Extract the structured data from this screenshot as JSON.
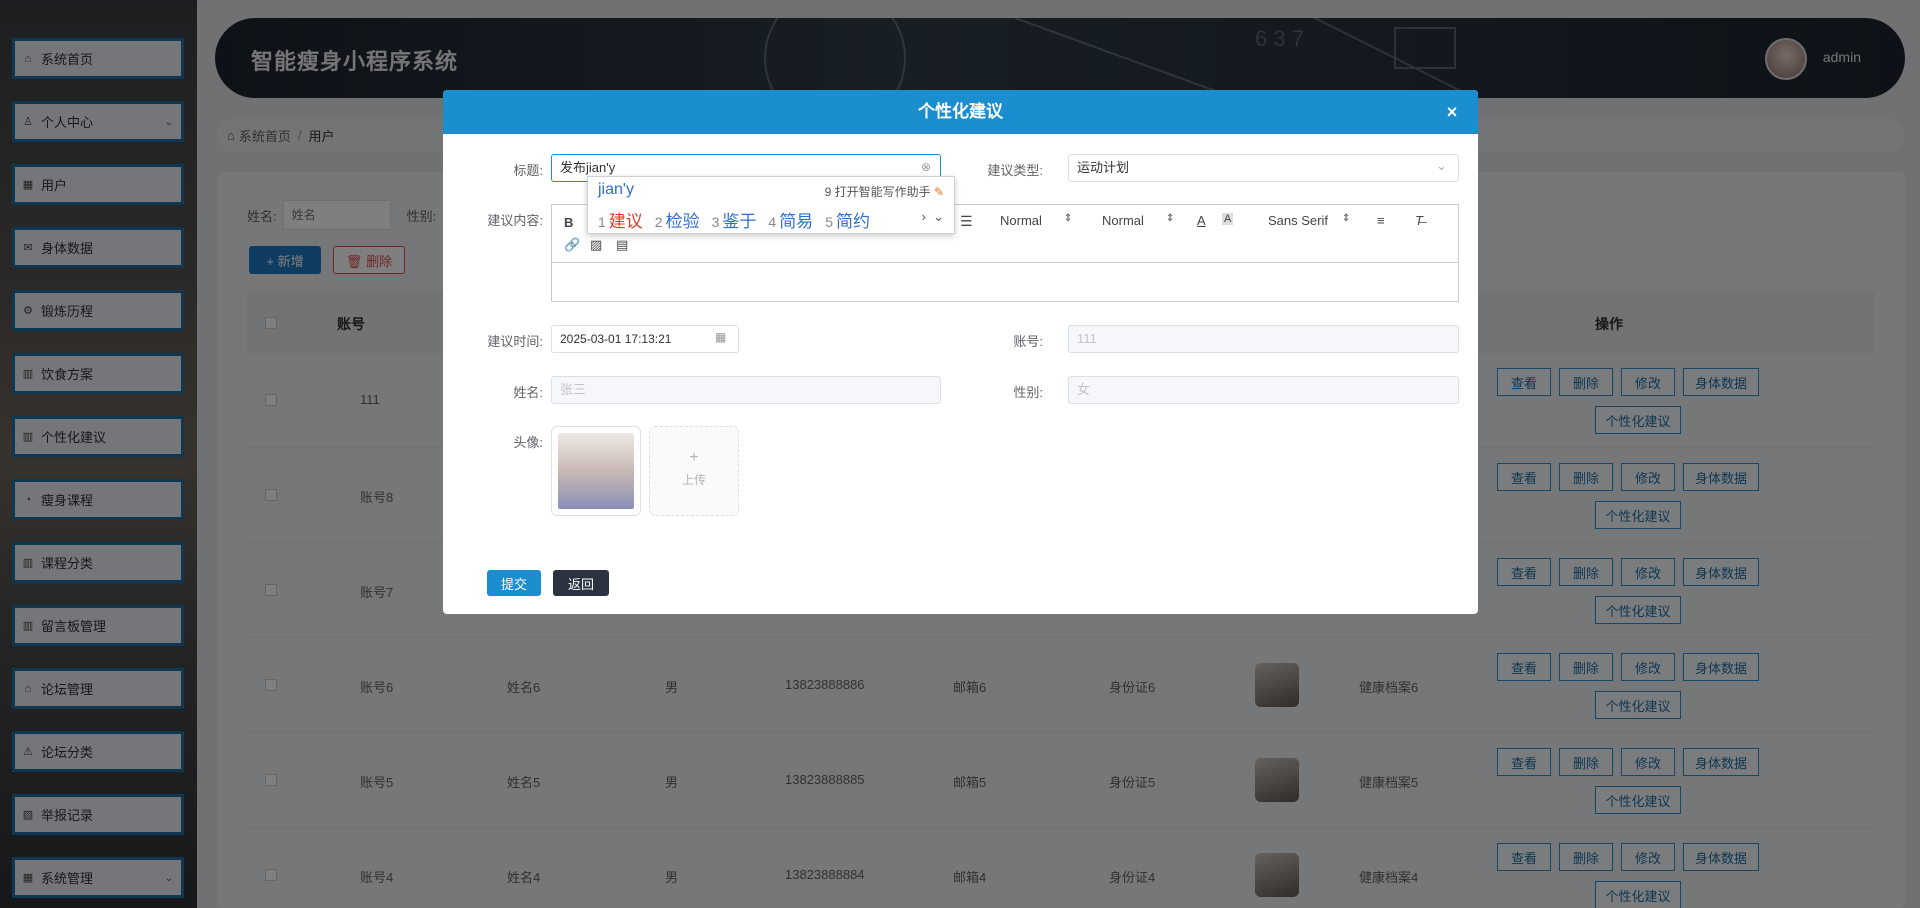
{
  "app": {
    "title": "智能瘦身小程序系统",
    "user": "admin"
  },
  "sidebar": {
    "items": [
      {
        "label": "系统首页",
        "icon": "home-icon",
        "glyph": "⌂"
      },
      {
        "label": "个人中心",
        "icon": "user-icon",
        "glyph": "♙",
        "expand": "⌄"
      },
      {
        "label": "用户",
        "icon": "grid-icon",
        "glyph": "▦"
      },
      {
        "label": "身体数据",
        "icon": "mail-icon",
        "glyph": "✉"
      },
      {
        "label": "锻炼历程",
        "icon": "gear-icon",
        "glyph": "⚙"
      },
      {
        "label": "饮食方案",
        "icon": "chart-icon",
        "glyph": "▥"
      },
      {
        "label": "个性化建议",
        "icon": "chart-icon",
        "glyph": "▥"
      },
      {
        "label": "瘦身课程",
        "icon": "compass-icon",
        "glyph": "◔"
      },
      {
        "label": "课程分类",
        "icon": "chart-icon",
        "glyph": "▥"
      },
      {
        "label": "留言板管理",
        "icon": "chart-icon",
        "glyph": "▥"
      },
      {
        "label": "论坛管理",
        "icon": "bank-icon",
        "glyph": "⌂"
      },
      {
        "label": "论坛分类",
        "icon": "warning-icon",
        "glyph": "⚠"
      },
      {
        "label": "举报记录",
        "icon": "image-icon",
        "glyph": "▧"
      },
      {
        "label": "系统管理",
        "icon": "grid-icon",
        "glyph": "▦",
        "expand": "⌄"
      }
    ]
  },
  "breadcrumb": {
    "home": "系统首页",
    "sep": "/",
    "current": "用户"
  },
  "search": {
    "name_label": "姓名:",
    "name_placeholder": "姓名",
    "gender_label": "性别:"
  },
  "actions": {
    "add": "+ 新增",
    "delete": "删除"
  },
  "table": {
    "headers": {
      "account": "账号",
      "ops": "操作"
    },
    "rows": [
      {
        "account": "111"
      },
      {
        "account": "账号8"
      },
      {
        "account": "账号7"
      },
      {
        "account": "账号6",
        "name": "姓名6",
        "gender": "男",
        "phone": "13823888886",
        "email": "邮箱6",
        "idcard": "身份证6",
        "archive": "健康档案6"
      },
      {
        "account": "账号5",
        "name": "姓名5",
        "gender": "男",
        "phone": "13823888885",
        "email": "邮箱5",
        "idcard": "身份证5",
        "archive": "健康档案5"
      },
      {
        "account": "账号4",
        "name": "姓名4",
        "gender": "男",
        "phone": "13823888884",
        "email": "邮箱4",
        "idcard": "身份证4",
        "archive": "健康档案4"
      }
    ],
    "op_labels": {
      "view": "查看",
      "del": "删除",
      "edit": "修改",
      "body": "身体数据",
      "advice": "个性化建议"
    }
  },
  "dialog": {
    "title": "个性化建议",
    "close": "×",
    "title_label": "标题:",
    "title_value": "发布jian'y",
    "type_label": "建议类型:",
    "type_value": "运动计划",
    "content_label": "建议内容:",
    "toolbar": {
      "bold": "B",
      "size1": "Normal",
      "size2": "Normal",
      "font": "Sans Serif"
    },
    "time_label": "建议时间:",
    "time_value": "2025-03-01 17:13:21",
    "account_label": "账号:",
    "account_value": "111",
    "name_label": "姓名:",
    "name_value": "张三",
    "gender_label": "性别:",
    "gender_value": "女",
    "avatar_label": "头像:",
    "upload_label": "上传",
    "submit": "提交",
    "back": "返回"
  },
  "ime": {
    "pinyin": "jian'y",
    "hint": "9 打开智能写作助手",
    "candidates": [
      {
        "n": "1",
        "text": "建议"
      },
      {
        "n": "2",
        "text": "检验"
      },
      {
        "n": "3",
        "text": "鉴于"
      },
      {
        "n": "4",
        "text": "简易"
      },
      {
        "n": "5",
        "text": "简约"
      }
    ]
  }
}
